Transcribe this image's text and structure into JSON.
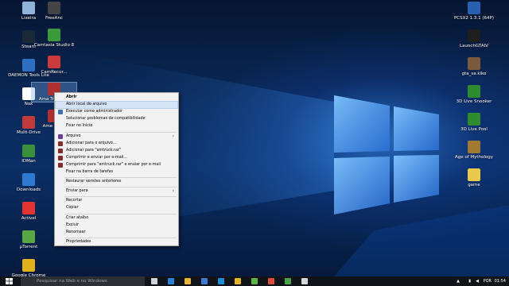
{
  "desktop": {
    "left_icons": [
      {
        "label": "Lixeira",
        "color": "#8fb3d9"
      },
      {
        "label": "Steam",
        "color": "#1b2838"
      },
      {
        "label": "DAEMON Tools Lite",
        "color": "#2d6fc0"
      },
      {
        "label": "Nox",
        "color": "#ffffff"
      },
      {
        "label": "Multi-Drive",
        "color": "#c23b3b"
      },
      {
        "label": "IDMan",
        "color": "#3b8f3b"
      },
      {
        "label": "Downloads",
        "color": "#2f7ad1"
      },
      {
        "label": "Activel",
        "color": "#e23333"
      },
      {
        "label": "µTorrent",
        "color": "#57a844"
      },
      {
        "label": "Google Chrome",
        "color": "#e0b11d"
      }
    ],
    "second_column_icons": [
      {
        "label": "FreeAnc",
        "color": "#444444"
      },
      {
        "label": "Camtasia Studio 8",
        "color": "#3a9b3a"
      },
      {
        "label": "CamRecor...",
        "color": "#cc3b3b"
      },
      {
        "label": "Ama Tru Simu",
        "color": "#b03030"
      },
      {
        "label": "Ame Truck",
        "color": "#b03030"
      }
    ],
    "right_icons": [
      {
        "label": "PCSX2 1.3.1 (64P)",
        "color": "#2a5fb0"
      },
      {
        "label": "LaunchGTAIV",
        "color": "#1e1e1e"
      },
      {
        "label": "gta_sa.kiko",
        "color": "#7a5a3a"
      },
      {
        "label": "3D Live Snooker",
        "color": "#2e8b2e"
      },
      {
        "label": "3D Live Pool",
        "color": "#2e8b2e"
      },
      {
        "label": "Age of Mythology",
        "color": "#a07a30"
      },
      {
        "label": "game",
        "color": "#e8c94a"
      }
    ]
  },
  "context_menu": {
    "items": [
      {
        "label": "Abrir",
        "bold": true,
        "icon": null
      },
      {
        "label": "Abrir local do arquivo",
        "highlighted": true,
        "icon": null
      },
      {
        "label": "Executar como administrador",
        "icon": "shield-icon",
        "icon_color": "#3a6fc4"
      },
      {
        "label": "Solucionar problemas de compatibilidade",
        "icon": null
      },
      {
        "label": "Fixar no Início",
        "icon": null
      },
      {
        "separator": true
      },
      {
        "label": "Arquivo",
        "icon": "archive-icon",
        "icon_color": "#6a3d9a",
        "submenu": true
      },
      {
        "label": "Adicionar para o arquivo...",
        "icon": "winrar-icon",
        "icon_color": "#8a2b2b"
      },
      {
        "label": "Adicionar para \"amtruck.rar\"",
        "icon": "winrar-icon",
        "icon_color": "#8a2b2b"
      },
      {
        "label": "Comprimir e enviar por e-mail...",
        "icon": "winrar-icon",
        "icon_color": "#8a2b2b"
      },
      {
        "label": "Comprimir para \"amtruck.rar\" e enviar por e-mail",
        "icon": "winrar-icon",
        "icon_color": "#8a2b2b"
      },
      {
        "label": "Fixar na barra de tarefas",
        "icon": null
      },
      {
        "separator": true
      },
      {
        "label": "Restaurar versões anteriores",
        "icon": null
      },
      {
        "separator": true
      },
      {
        "label": "Enviar para",
        "icon": null,
        "submenu": true
      },
      {
        "separator": true
      },
      {
        "label": "Recortar",
        "icon": null
      },
      {
        "label": "Copiar",
        "icon": null
      },
      {
        "separator": true
      },
      {
        "label": "Criar atalho",
        "icon": null
      },
      {
        "label": "Excluir",
        "icon": null
      },
      {
        "label": "Renomear",
        "icon": null
      },
      {
        "separator": true
      },
      {
        "label": "Propriedades",
        "icon": null
      }
    ]
  },
  "taskbar": {
    "search_placeholder": "Pesquisar na Web e no Windows",
    "apps": [
      {
        "name": "task-view",
        "color": "#cfd3d8"
      },
      {
        "name": "edge",
        "color": "#2a7fd8"
      },
      {
        "name": "file-explorer",
        "color": "#e7b53c"
      },
      {
        "name": "store",
        "color": "#3a7bd5"
      },
      {
        "name": "edge-browser",
        "color": "#1f8ad6"
      },
      {
        "name": "chrome",
        "color": "#e2b71f"
      },
      {
        "name": "utorrent",
        "color": "#5ab546"
      },
      {
        "name": "chrome-2",
        "color": "#dd4b39"
      },
      {
        "name": "camtasia",
        "color": "#47a447"
      },
      {
        "name": "media",
        "color": "#d6d6d6"
      }
    ],
    "tray": {
      "language": "POR",
      "time": "01:54"
    }
  }
}
